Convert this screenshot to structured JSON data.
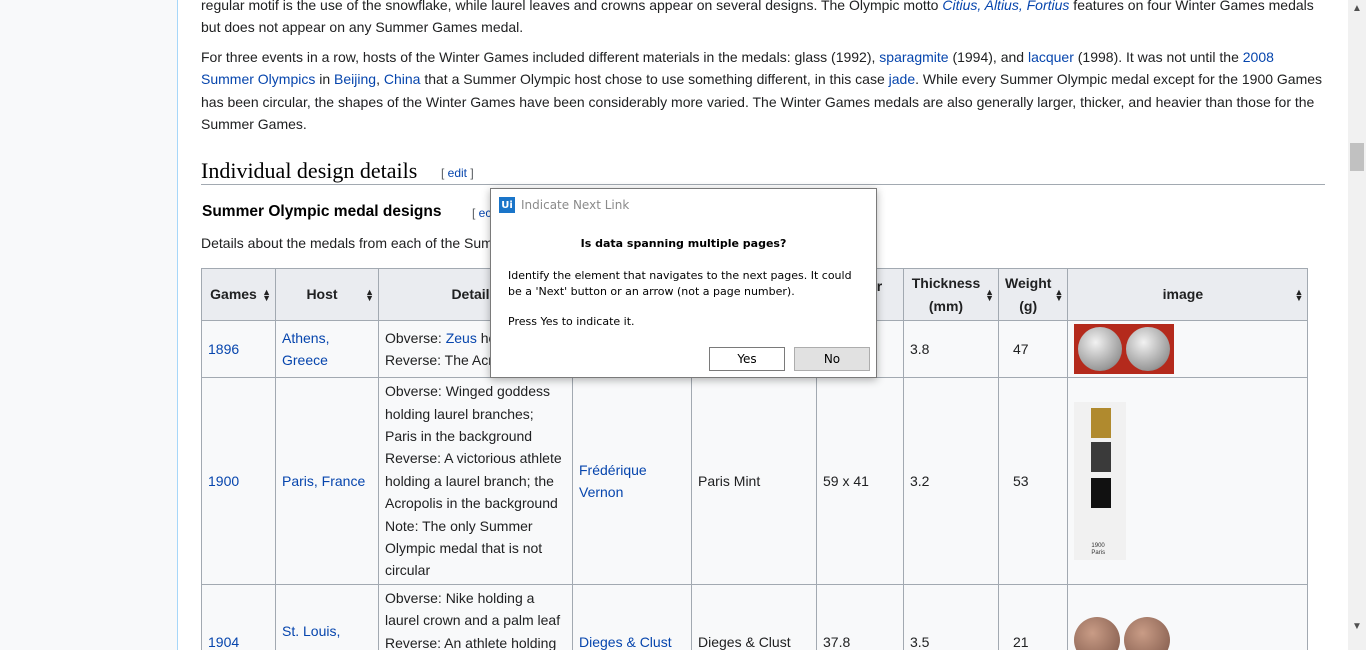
{
  "intro": {
    "p1_a": "regular motif is the use of the snowflake, while laurel leaves and crowns appear on several designs. The Olympic motto ",
    "p1_motto": "Citius, Altius, Fortius",
    "p1_b": " features on four Winter Games medals but does not appear on any Summer Games medal.",
    "p2_a": "For three events in a row, hosts of the Winter Games included different materials in the medals: glass (1992), ",
    "p2_l1": "sparagmite",
    "p2_b": " (1994), and ",
    "p2_l2": "lacquer",
    "p2_c": " (1998). It was not until the ",
    "p2_l3": "2008 Summer Olympics",
    "p2_d": " in ",
    "p2_l4": "Beijing",
    "p2_comma": ", ",
    "p2_l5": "China",
    "p2_e": " that a Summer Olympic host chose to use something different, in this case ",
    "p2_l6": "jade",
    "p2_f": ". While every Summer Olympic medal except for the 1900 Games has been circular, the shapes of the Winter Games have been considerably more varied. The Winter Games medals are also generally larger, thicker, and heavier than those for the Summer Games."
  },
  "section": {
    "title": "Individual design details",
    "edit_open": "[ ",
    "edit": "edit",
    "edit_close": " ]"
  },
  "subsection": {
    "title": "Summer Olympic medal designs",
    "edit_open": "[ ",
    "edit": "ec",
    "caption": "Details about the medals from each of the Sum"
  },
  "table": {
    "headers": [
      "Games",
      "Host",
      "Detail",
      "er",
      "Thickness (mm)",
      "Weight (g)",
      "image"
    ],
    "thickness_l1": "Thickness",
    "thickness_l2": "(mm)",
    "weight_l1": "Weight",
    "weight_l2": "(g)",
    "rows": [
      {
        "games": "1896",
        "host_l1": "Athens,",
        "host_l2": "Greece",
        "detail_l1_a": "Obverse: ",
        "detail_l1_link": "Zeus",
        "detail_l1_b": " ho",
        "detail_l2": "Reverse: The Acr",
        "thickness": "3.8",
        "weight": "47"
      },
      {
        "games": "1900",
        "host": "Paris, France",
        "detail": [
          "Obverse: Winged goddess",
          "holding laurel branches;",
          "Paris in the background",
          "Reverse: A victorious athlete",
          "holding a laurel branch; the",
          "Acropolis in the background",
          "Note: The only Summer",
          "Olympic medal that is not",
          "circular"
        ],
        "designer_l1": "Frédérique",
        "designer_l2": "Vernon",
        "mint": "Paris Mint",
        "diameter": "59 x 41",
        "thickness": "3.2",
        "weight": "53",
        "image_label_l1": "1900",
        "image_label_l2": "Paris"
      },
      {
        "games": "1904",
        "host": "St. Louis,",
        "detail": [
          "Obverse: Nike holding a",
          "laurel crown and a palm leaf",
          "Reverse: An athlete holding"
        ],
        "designer": "Dieges & Clust",
        "mint": "Dieges & Clust",
        "diameter": "37.8",
        "thickness": "3.5",
        "weight": "21"
      }
    ]
  },
  "dialog": {
    "logo": "Ui",
    "title": "Indicate Next Link",
    "question": "Is data spanning multiple pages?",
    "body1": "Identify the element that navigates to the next pages. It could be a 'Next' button or an arrow (not a page number).",
    "body2": "Press Yes to indicate it.",
    "yes": "Yes",
    "no": "No"
  },
  "icons": {
    "sort": "sort-arrows-icon",
    "scroll_up": "scroll-up-icon",
    "scroll_down": "scroll-down-icon"
  }
}
